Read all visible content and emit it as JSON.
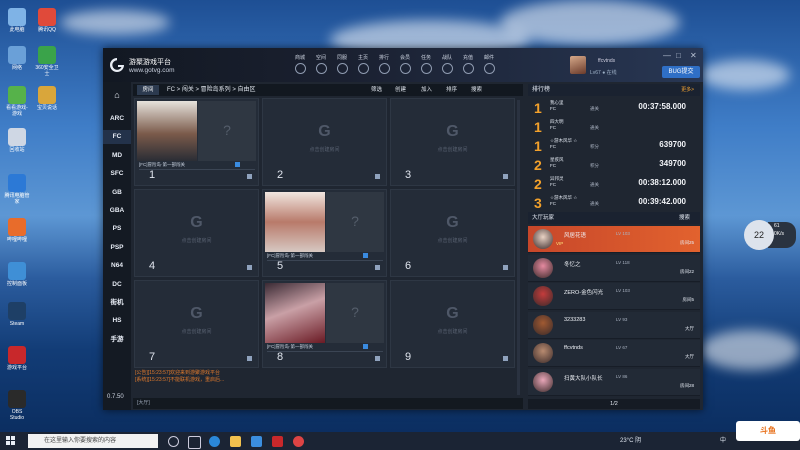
{
  "desktop": {
    "icons": [
      {
        "label": "此电脑",
        "color": "#7fb3e6"
      },
      {
        "label": "腾讯QQ",
        "color": "#e04a3a"
      },
      {
        "label": "网络",
        "color": "#6aa0d8"
      },
      {
        "label": "360安全卫士",
        "color": "#3aa34a"
      },
      {
        "label": "看看游戏-游戏",
        "color": "#56b24a"
      },
      {
        "label": "宝贝说话",
        "color": "#d9a63b"
      },
      {
        "label": "回收站",
        "color": "#cfd7e4"
      },
      {
        "label": "腾讯电脑管家",
        "color": "#2c79d6"
      },
      {
        "label": "哔哩哔哩",
        "color": "#e86c2b"
      },
      {
        "label": "控制面板",
        "color": "#3f8fd6"
      },
      {
        "label": "Steam",
        "color": "#1e3f66"
      },
      {
        "label": "游戏平台",
        "color": "#c8282b"
      },
      {
        "label": "OBS Studio",
        "color": "#2a2a2a"
      }
    ]
  },
  "app": {
    "name": "游聚游戏平台",
    "url": "www.gotvg.com",
    "nav": [
      "商城",
      "空间",
      "同服",
      "主页",
      "排行",
      "会员",
      "任务",
      "战队",
      "充值",
      "邮件"
    ],
    "user": {
      "name": "ffcvtnds",
      "level": "Lv67",
      "status": "在线"
    },
    "bug_button": "BUG提交",
    "window_controls": [
      "—",
      "□",
      "✕"
    ]
  },
  "sidebar": {
    "items": [
      "ARC",
      "FC",
      "MD",
      "SFC",
      "GB",
      "GBA",
      "PS",
      "PSP",
      "N64",
      "DC",
      "街机",
      "HS",
      "手游"
    ],
    "active_index": 1,
    "version": "0.7.50"
  },
  "room": {
    "tab": "房间",
    "breadcrumb": "FC > 闯关 > 冒险岛系列 > 自由区",
    "actions": [
      "筛选",
      "创建",
      "加入",
      "排序",
      "搜索"
    ],
    "empty_hint": "点击创建房间",
    "cells": [
      {
        "number": "1",
        "occupied": true,
        "label": "[FC]冒险岛·第一部闯关"
      },
      {
        "number": "2",
        "occupied": false,
        "label": ""
      },
      {
        "number": "3",
        "occupied": false,
        "label": ""
      },
      {
        "number": "4",
        "occupied": false,
        "label": ""
      },
      {
        "number": "5",
        "occupied": true,
        "label": "[FC]冒险岛·第一部闯关"
      },
      {
        "number": "6",
        "occupied": false,
        "label": ""
      },
      {
        "number": "7",
        "occupied": false,
        "label": ""
      },
      {
        "number": "8",
        "occupied": true,
        "label": "[FC]冒险岛·第一部闯关"
      },
      {
        "number": "9",
        "occupied": false,
        "label": ""
      }
    ],
    "messages": [
      "[公告][15:23:57]欢迎来到游聚游戏平台",
      "[系统][15:23:57]不能联机游戏，重启后..."
    ],
    "chat_placeholder": "[大厅]"
  },
  "ranking": {
    "title": "排行榜",
    "more": "更多>",
    "rows": [
      {
        "rank": "1",
        "name": "我心里",
        "sub": "FC",
        "tag": "通关",
        "score": "00:37:58.000"
      },
      {
        "rank": "1",
        "name": "四大明",
        "sub": "FC",
        "tag": "通关",
        "score": ""
      },
      {
        "rank": "1",
        "name": "☆游木风华 ☆",
        "sub": "FC",
        "tag": "积分",
        "score": "639700"
      },
      {
        "rank": "2",
        "name": "星疾风",
        "sub": "FC",
        "tag": "积分",
        "score": "349700"
      },
      {
        "rank": "2",
        "name": "异邦灵",
        "sub": "FC",
        "tag": "通关",
        "score": "00:38:12.000"
      },
      {
        "rank": "3",
        "name": "☆游木风华 ☆",
        "sub": "FC",
        "tag": "通关",
        "score": "00:39:42.000"
      }
    ]
  },
  "lobby": {
    "title": "大厅玩家",
    "search": "搜索",
    "players": [
      {
        "name": "风居花语",
        "level": "LV 103",
        "room": "房间25",
        "sub": "VIP",
        "selected": true,
        "avatar": "#e9d2c4"
      },
      {
        "name": "冬忆之",
        "level": "LV 118",
        "room": "房间22",
        "sub": "",
        "selected": false,
        "avatar": "#e58aa0"
      },
      {
        "name": "ZERO-金色闪光",
        "level": "LV 103",
        "room": "房间5",
        "sub": "",
        "selected": false,
        "avatar": "#c43c3c"
      },
      {
        "name": "3233283",
        "level": "LV 93",
        "room": "大厅",
        "sub": "",
        "selected": false,
        "avatar": "#a05a32"
      },
      {
        "name": "ffcvtnds",
        "level": "LV 67",
        "room": "大厅",
        "sub": "",
        "selected": false,
        "avatar": "#b88b70"
      },
      {
        "name": "扫黄大队小队长",
        "level": "LV 86",
        "room": "房间28",
        "sub": "",
        "selected": false,
        "avatar": "#e8a6b8"
      }
    ],
    "pager": "1/2"
  },
  "taskbar": {
    "search_placeholder": "在这里输入你要搜索的内容",
    "weather": "23°C 阴",
    "lang": "中",
    "time": "15:24"
  },
  "overlay": {
    "gauge": "22",
    "gauge_sub1": "61",
    "gauge_sub2": "0K/s",
    "watermark": "斗鱼"
  }
}
